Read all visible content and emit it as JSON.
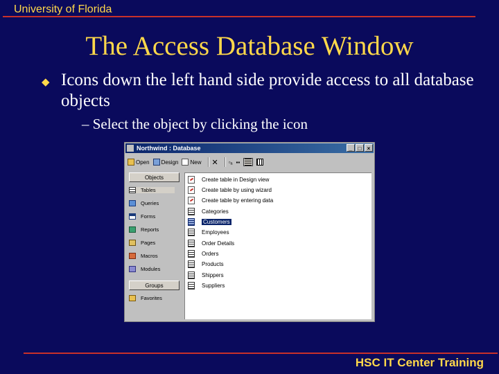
{
  "slide": {
    "header": "University of Florida",
    "title": "The Access Database Window",
    "bullet_symbol": "u",
    "bullet_text": "Icons down the left hand side provide access to all database objects",
    "sub_bullet": "– Select the object by clicking the icon",
    "footer": "HSC IT Center Training",
    "colors": {
      "background": "#0a0a5c",
      "accent": "#ffd84a",
      "rule": "#c8312a"
    }
  },
  "window": {
    "title": "Northwind : Database",
    "controls": [
      "_",
      "□",
      "×"
    ],
    "toolbar": [
      {
        "label": "Open",
        "icon": "open-icon"
      },
      {
        "label": "Design",
        "icon": "design-icon"
      },
      {
        "label": "New",
        "icon": "new-icon"
      }
    ],
    "toolbar_icons": [
      "delete-icon",
      "large-icons-icon",
      "small-icons-icon",
      "list-icon",
      "details-icon"
    ],
    "objects_label": "Objects",
    "objects": [
      {
        "label": "Tables",
        "icon": "table-icon"
      },
      {
        "label": "Queries",
        "icon": "query-icon"
      },
      {
        "label": "Forms",
        "icon": "form-icon"
      },
      {
        "label": "Reports",
        "icon": "report-icon"
      },
      {
        "label": "Pages",
        "icon": "page-icon"
      },
      {
        "label": "Macros",
        "icon": "macro-icon"
      },
      {
        "label": "Modules",
        "icon": "module-icon"
      }
    ],
    "groups_label": "Groups",
    "groups": [
      {
        "label": "Favorites",
        "icon": "favorites-icon"
      }
    ],
    "items": [
      {
        "label": "Create table in Design view",
        "type": "wizard"
      },
      {
        "label": "Create table by using wizard",
        "type": "wizard"
      },
      {
        "label": "Create table by entering data",
        "type": "wizard"
      },
      {
        "label": "Categories",
        "type": "table"
      },
      {
        "label": "Customers",
        "type": "table",
        "selected": true
      },
      {
        "label": "Employees",
        "type": "table"
      },
      {
        "label": "Order Details",
        "type": "table"
      },
      {
        "label": "Orders",
        "type": "table"
      },
      {
        "label": "Products",
        "type": "table"
      },
      {
        "label": "Shippers",
        "type": "table"
      },
      {
        "label": "Suppliers",
        "type": "table"
      }
    ]
  }
}
